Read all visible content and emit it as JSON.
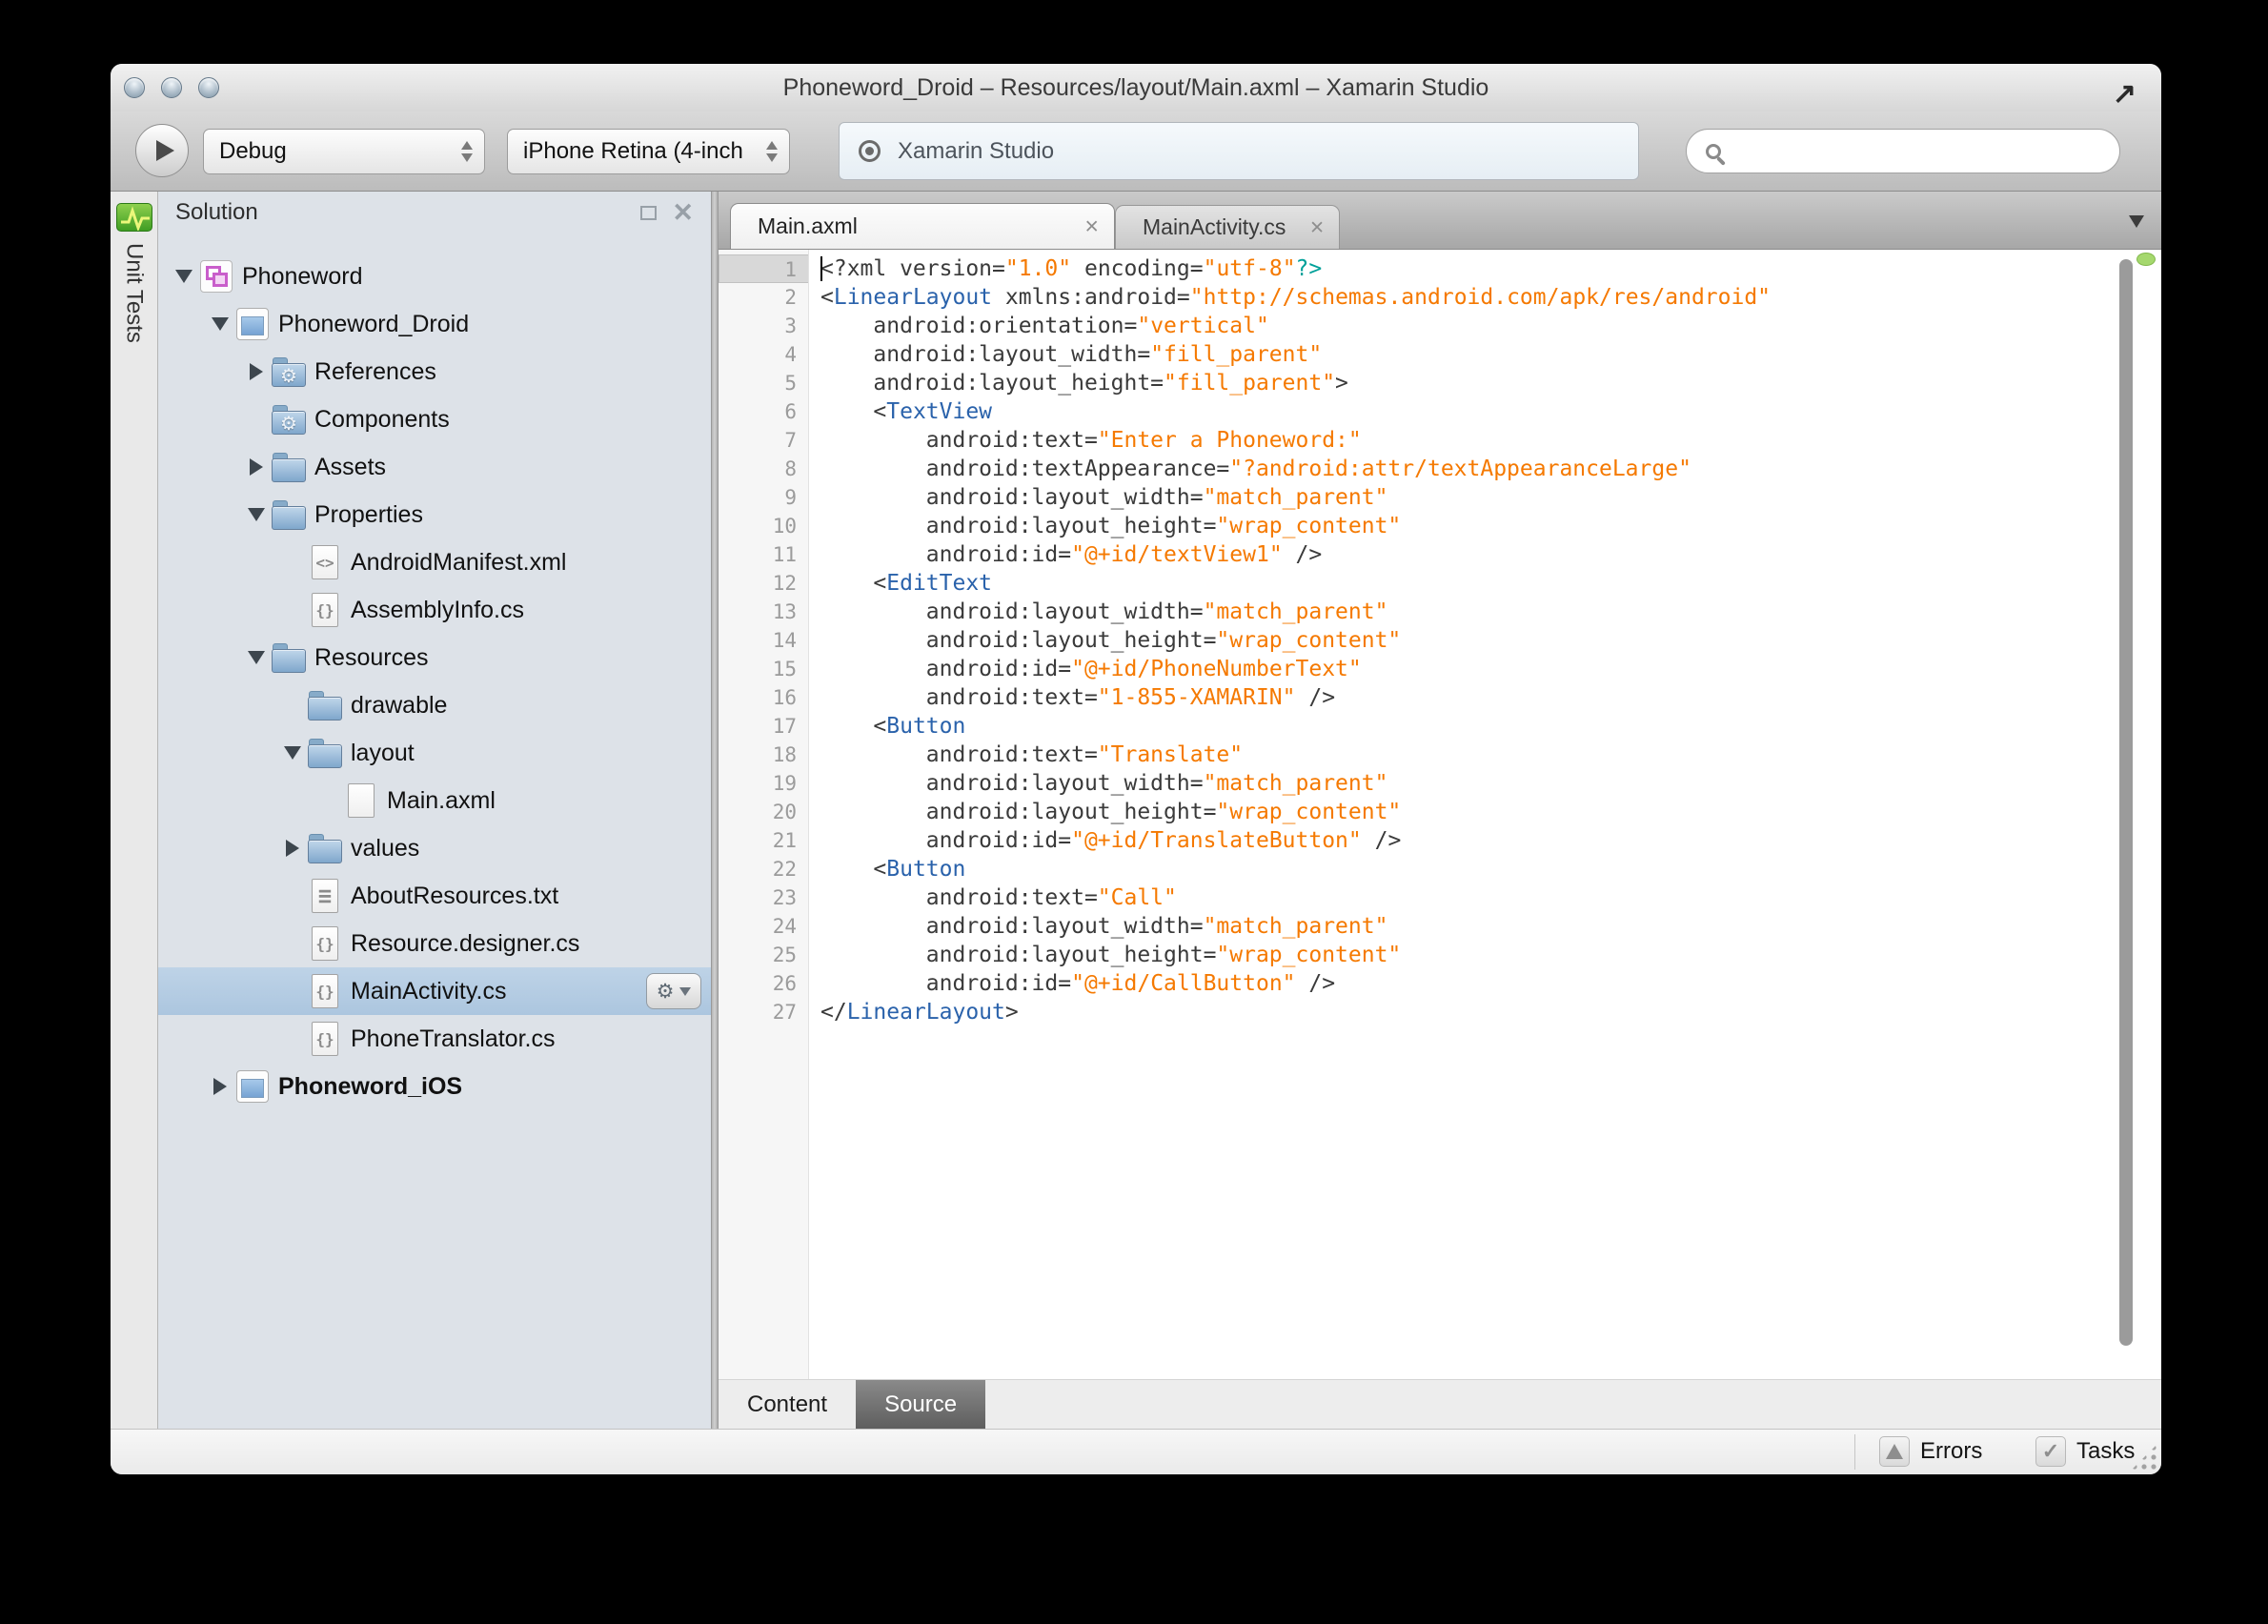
{
  "window": {
    "title": "Phoneword_Droid – Resources/layout/Main.axml – Xamarin Studio"
  },
  "toolbar": {
    "configuration": "Debug",
    "device": "iPhone Retina (4-inch",
    "status_text": "Xamarin Studio",
    "search_value": ""
  },
  "dock": {
    "unit_tests": "Unit Tests"
  },
  "solution_pad": {
    "title": "Solution",
    "items": [
      {
        "label": "Phoneword",
        "level": 0,
        "arrow": "down",
        "icon": "solution"
      },
      {
        "label": "Phoneword_Droid",
        "level": 1,
        "arrow": "down",
        "icon": "project"
      },
      {
        "label": "References",
        "level": 2,
        "arrow": "right",
        "icon": "folder-gear"
      },
      {
        "label": "Components",
        "level": 2,
        "arrow": null,
        "icon": "folder-gear"
      },
      {
        "label": "Assets",
        "level": 2,
        "arrow": "right",
        "icon": "folder"
      },
      {
        "label": "Properties",
        "level": 2,
        "arrow": "down",
        "icon": "folder"
      },
      {
        "label": "AndroidManifest.xml",
        "level": 3,
        "arrow": null,
        "icon": "file-xml"
      },
      {
        "label": "AssemblyInfo.cs",
        "level": 3,
        "arrow": null,
        "icon": "file-cs"
      },
      {
        "label": "Resources",
        "level": 2,
        "arrow": "down",
        "icon": "folder"
      },
      {
        "label": "drawable",
        "level": 3,
        "arrow": null,
        "icon": "folder"
      },
      {
        "label": "layout",
        "level": 3,
        "arrow": "down",
        "icon": "folder"
      },
      {
        "label": "Main.axml",
        "level": 4,
        "arrow": null,
        "icon": "file-plain"
      },
      {
        "label": "values",
        "level": 3,
        "arrow": "right",
        "icon": "folder"
      },
      {
        "label": "AboutResources.txt",
        "level": 3,
        "arrow": null,
        "icon": "file-text"
      },
      {
        "label": "Resource.designer.cs",
        "level": 3,
        "arrow": null,
        "icon": "file-cs"
      },
      {
        "label": "MainActivity.cs",
        "level": 3,
        "arrow": null,
        "icon": "file-cs",
        "selected": true,
        "gear": true
      },
      {
        "label": "PhoneTranslator.cs",
        "level": 3,
        "arrow": null,
        "icon": "file-cs"
      },
      {
        "label": "Phoneword_iOS",
        "level": 1,
        "arrow": "right",
        "icon": "project",
        "bold": true
      }
    ]
  },
  "icon_glyphs": {
    "file-cs": "{}",
    "file-xml": "<>",
    "file-text": "≡",
    "file-plain": ""
  },
  "editor": {
    "tabs": [
      {
        "label": "Main.axml",
        "active": true
      },
      {
        "label": "MainActivity.cs",
        "active": false
      }
    ],
    "bottom_tabs": [
      {
        "label": "Content",
        "active": false
      },
      {
        "label": "Source",
        "active": true
      }
    ],
    "code_lines": [
      [
        [
          "<?xml version=",
          "p"
        ],
        [
          "\"1.0\"",
          "s"
        ],
        [
          " encoding=",
          "p"
        ],
        [
          "\"utf-8\"",
          "s"
        ],
        [
          "?>",
          "t"
        ]
      ],
      [
        [
          "<",
          "p"
        ],
        [
          "LinearLayout",
          "e"
        ],
        [
          " xmlns:android=",
          "p"
        ],
        [
          "\"http://schemas.android.com/apk/res/android\"",
          "s"
        ]
      ],
      [
        [
          "    android:orientation=",
          "p"
        ],
        [
          "\"vertical\"",
          "s"
        ]
      ],
      [
        [
          "    android:layout_width=",
          "p"
        ],
        [
          "\"fill_parent\"",
          "s"
        ]
      ],
      [
        [
          "    android:layout_height=",
          "p"
        ],
        [
          "\"fill_parent\"",
          "s"
        ],
        [
          ">",
          "p"
        ]
      ],
      [
        [
          "    <",
          "p"
        ],
        [
          "TextView",
          "e"
        ]
      ],
      [
        [
          "        android:text=",
          "p"
        ],
        [
          "\"Enter a Phoneword:\"",
          "s"
        ]
      ],
      [
        [
          "        android:textAppearance=",
          "p"
        ],
        [
          "\"?android:attr/textAppearanceLarge\"",
          "s"
        ]
      ],
      [
        [
          "        android:layout_width=",
          "p"
        ],
        [
          "\"match_parent\"",
          "s"
        ]
      ],
      [
        [
          "        android:layout_height=",
          "p"
        ],
        [
          "\"wrap_content\"",
          "s"
        ]
      ],
      [
        [
          "        android:id=",
          "p"
        ],
        [
          "\"@+id/textView1\"",
          "s"
        ],
        [
          " />",
          "p"
        ]
      ],
      [
        [
          "    <",
          "p"
        ],
        [
          "EditText",
          "e"
        ]
      ],
      [
        [
          "        android:layout_width=",
          "p"
        ],
        [
          "\"match_parent\"",
          "s"
        ]
      ],
      [
        [
          "        android:layout_height=",
          "p"
        ],
        [
          "\"wrap_content\"",
          "s"
        ]
      ],
      [
        [
          "        android:id=",
          "p"
        ],
        [
          "\"@+id/PhoneNumberText\"",
          "s"
        ]
      ],
      [
        [
          "        android:text=",
          "p"
        ],
        [
          "\"1-855-XAMARIN\"",
          "s"
        ],
        [
          " />",
          "p"
        ]
      ],
      [
        [
          "    <",
          "p"
        ],
        [
          "Button",
          "e"
        ]
      ],
      [
        [
          "        android:text=",
          "p"
        ],
        [
          "\"Translate\"",
          "s"
        ]
      ],
      [
        [
          "        android:layout_width=",
          "p"
        ],
        [
          "\"match_parent\"",
          "s"
        ]
      ],
      [
        [
          "        android:layout_height=",
          "p"
        ],
        [
          "\"wrap_content\"",
          "s"
        ]
      ],
      [
        [
          "        android:id=",
          "p"
        ],
        [
          "\"@+id/TranslateButton\"",
          "s"
        ],
        [
          " />",
          "p"
        ]
      ],
      [
        [
          "    <",
          "p"
        ],
        [
          "Button",
          "e"
        ]
      ],
      [
        [
          "        android:text=",
          "p"
        ],
        [
          "\"Call\"",
          "s"
        ]
      ],
      [
        [
          "        android:layout_width=",
          "p"
        ],
        [
          "\"match_parent\"",
          "s"
        ]
      ],
      [
        [
          "        android:layout_height=",
          "p"
        ],
        [
          "\"wrap_content\"",
          "s"
        ]
      ],
      [
        [
          "        android:id=",
          "p"
        ],
        [
          "\"@+id/CallButton\"",
          "s"
        ],
        [
          " />",
          "p"
        ]
      ],
      [
        [
          "</",
          "p"
        ],
        [
          "LinearLayout",
          "e"
        ],
        [
          ">",
          "p"
        ]
      ]
    ]
  },
  "statusbar": {
    "errors": "Errors",
    "tasks": "Tasks"
  },
  "colors": {
    "code": {
      "p": "#3a3a3a",
      "e": "#2a62ab",
      "s": "#f57900",
      "t": "#00a099"
    },
    "selection": "#b9cfe4",
    "line_number": "#9b9b9b",
    "green_indicator": "#a5d86e"
  }
}
